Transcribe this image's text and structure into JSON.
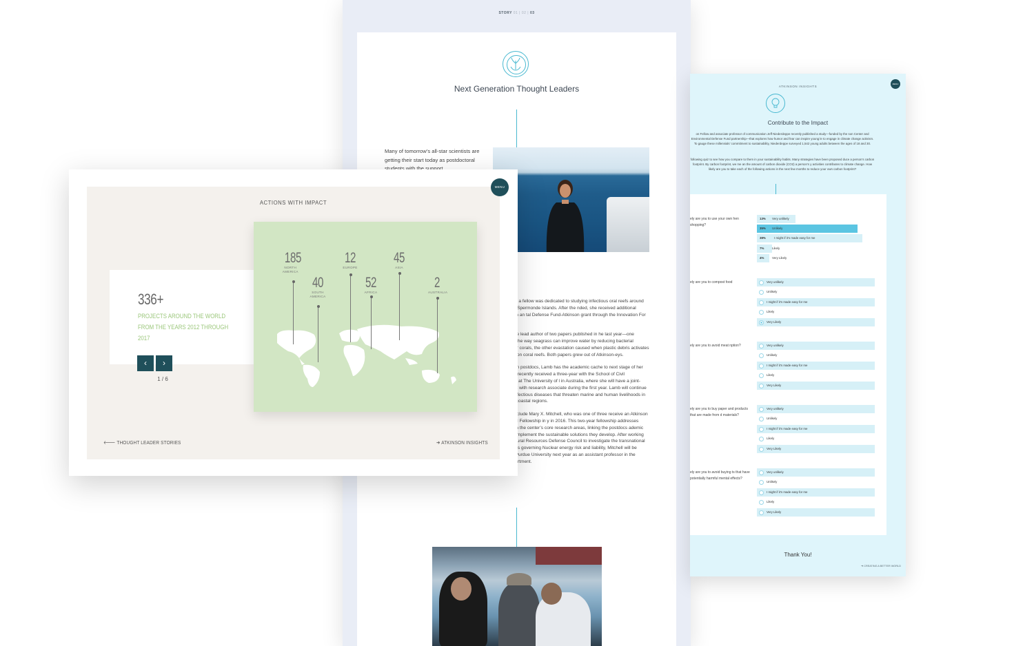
{
  "story": {
    "breadcrumb": {
      "prefix": "STORY",
      "dim": "01 | 02 |",
      "current": "03"
    },
    "title": "Next Generation Thought Leaders",
    "lede": "Many of tomorrow’s all-star scientists are getting their start today as postdoctoral students with the support",
    "paragraphs": [
      "year stint as a fellow was dedicated to studying infectious oral reefs around Indonesia’s Spermonde Islands. After the nded, she received additional support from an tal Defense Fund-Atkinson grant through the Innovation For d.",
      "nce been the lead author of two papers published in he last year—one concerning the way seagrass can improve water by reducing bacterial exposure for corals, the other evastation caused when plastic debris activates new isease on coral reefs. Both papers grew out of Atkinson-eys.",
      "ther Atkinson postdocs, Lamb has the academic cache to next stage of her career. She recently received a three-year with the School of Civil Engineering at The University of l in Australia, where she will have a joint-appointment with research associate during the first year. Lamb will continue mitigating infectious diseases that threaten marine and human livelihoods in developing coastal regions.",
      "ss stories include Mary X. Mitchell, who was one of three receive an Atkinson Postdoctoral Fellowship in y in 2016. This two-year fellowship addresses pressing s in the center’s core research areas, linking the postdocs ademic partners to implement the sustainable solutions they develop. After working with the Natural Resources Defense Council to investigate the transnational legal regimes governing Nuclear energy risk and liability, Mitchell will be heading to Purdue University next year as an assistant professor in the history department."
    ]
  },
  "quiz": {
    "brand": "ATKINSON INSIGHTS",
    "menu": "MENU",
    "title": "Contribute to the Impact",
    "intro1": "on Fellow and associate professor of communication Jeff Niederdeppe recently published a study—funded by the son Center and Environmental Defense Fund partnership—that explores how humor and fear can inspire young le to engage in climate change activism. To gauge these millennials’ commitment to sustainability, Niederdeppe surveyed 1,542 young adults between the ages of 18 and 30.",
    "intro2": "following quiz to see how you compare to them in your sustainability habits. Many strategies have been proposed duce a person’s carbon footprint. By carbon footprint, we me an the amount of carbon dioxide (CO2) a person’s y activities contributes to climate change. How likely are you to take each of the following actions in the next few months to reduce your own carbon footprint?",
    "q1": "ely are you to use your own hen shopping?",
    "q1_results": [
      {
        "pct": "13%",
        "label": "Very unlikely",
        "value": 13
      },
      {
        "pct": "35%",
        "label": "Unlikely",
        "value": 35
      },
      {
        "pct": "38%",
        "label": "I might if it’s made easy for me",
        "value": 38
      },
      {
        "pct": "7%",
        "label": "Likely",
        "value": 7
      },
      {
        "pct": "4%",
        "label": "Very Likely",
        "value": 4
      }
    ],
    "questions": [
      "ely are you to compost food",
      "ely are you to avoid meat nption?",
      "ely are you to buy paper and products that are made from d materials?",
      "ely are you to avoid buying ts that have potentially harmful mental effects?"
    ],
    "options": [
      "Very unlikely",
      "Unlikely",
      "I might if it’s made easy for me",
      "Likely",
      "Very Likely"
    ],
    "thanks": "Thank You!",
    "footer": "➔ CREATING A BETTER WORLD"
  },
  "actions": {
    "heading": "ACTIONS WITH IMPACT",
    "menu": "MENU",
    "big_number": "336+",
    "subtitle": "PROJECTS AROUND THE WORLD FROM THE YEARS 2012 THROUGH 2017",
    "prev_icon": "‹",
    "next_icon": "›",
    "pager": "1 / 6",
    "regions": [
      {
        "num": "185",
        "name": "NORTH AMERICA"
      },
      {
        "num": "40",
        "name": "SOUTH AMERICA"
      },
      {
        "num": "12",
        "name": "EUROPE"
      },
      {
        "num": "52",
        "name": "AFRICA"
      },
      {
        "num": "45",
        "name": "ASIA"
      },
      {
        "num": "2",
        "name": "AUSTRALIA"
      }
    ],
    "back_link": "THOUGHT LEADER STORIES",
    "forward_link": "ATKINSON INSIGHTS"
  },
  "colors": {
    "accent": "#48b8d0",
    "dark_teal": "#1f4f5a",
    "green": "#9bc77b",
    "map_bg": "#d2e6c4",
    "quiz_bg": "#dff5fb"
  }
}
